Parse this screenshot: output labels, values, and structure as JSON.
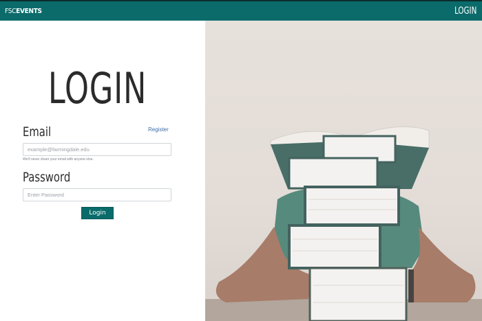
{
  "nav": {
    "brand_prefix": "FSC",
    "brand_suffix": "EVENTS",
    "login_link": "LOGIN"
  },
  "form": {
    "title": "LOGIN",
    "email_label": "Email",
    "register_link": "Register",
    "email_placeholder": "example@farmingdale.edu",
    "email_help": "We'll never share your email with anyone else.",
    "password_label": "Password",
    "password_placeholder": "Enter Password",
    "submit_label": "Login"
  },
  "colors": {
    "brand_teal": "#0b6b6b",
    "link_blue": "#3b6ea8"
  }
}
